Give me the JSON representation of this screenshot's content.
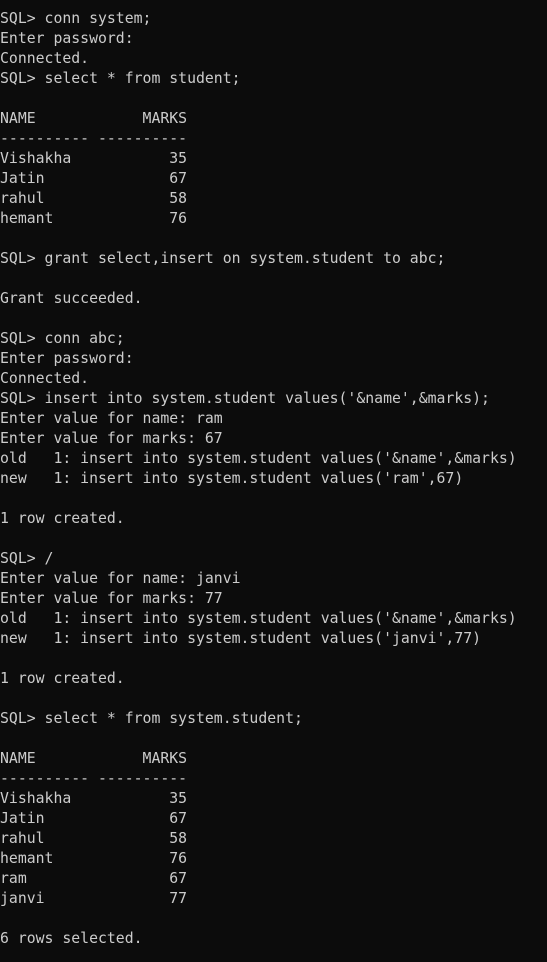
{
  "console": {
    "lines": [
      "SQL> conn system;",
      "Enter password:",
      "Connected.",
      "SQL> select * from student;",
      "",
      "NAME            MARKS",
      "---------- ----------",
      "Vishakha           35",
      "Jatin              67",
      "rahul              58",
      "hemant             76",
      "",
      "SQL> grant select,insert on system.student to abc;",
      "",
      "Grant succeeded.",
      "",
      "SQL> conn abc;",
      "Enter password:",
      "Connected.",
      "SQL> insert into system.student values('&name',&marks);",
      "Enter value for name: ram",
      "Enter value for marks: 67",
      "old   1: insert into system.student values('&name',&marks)",
      "new   1: insert into system.student values('ram',67)",
      "",
      "1 row created.",
      "",
      "SQL> /",
      "Enter value for name: janvi",
      "Enter value for marks: 77",
      "old   1: insert into system.student values('&name',&marks)",
      "new   1: insert into system.student values('janvi',77)",
      "",
      "1 row created.",
      "",
      "SQL> select * from system.student;",
      "",
      "NAME            MARKS",
      "---------- ----------",
      "Vishakha           35",
      "Jatin              67",
      "rahul              58",
      "hemant             76",
      "ram                67",
      "janvi              77",
      "",
      "6 rows selected."
    ]
  }
}
